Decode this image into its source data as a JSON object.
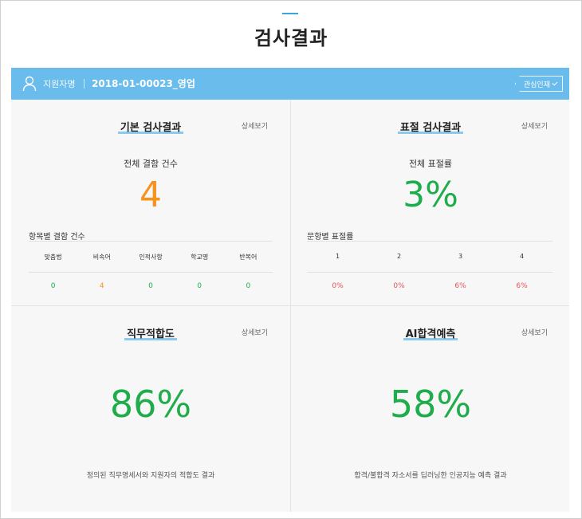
{
  "page_title": "검사결과",
  "applicant": {
    "label": "지원자명",
    "id": "2018-01-00023_영업",
    "interest_button": "관심인재"
  },
  "basic": {
    "title": "기본 검사결과",
    "detail": "상세보기",
    "total_label": "전체 결함 건수",
    "total_value": "4",
    "table_label": "항목별 결함 건수",
    "columns": [
      "맞춤법",
      "비속어",
      "인적사항",
      "학교명",
      "반복어"
    ],
    "values": [
      "0",
      "4",
      "0",
      "0",
      "0"
    ]
  },
  "plagiarism": {
    "title": "표절 검사결과",
    "detail": "상세보기",
    "total_label": "전체 표절률",
    "total_value": "3%",
    "table_label": "문항별 표절률",
    "columns": [
      "1",
      "2",
      "3",
      "4"
    ],
    "values": [
      "0%",
      "0%",
      "6%",
      "6%"
    ]
  },
  "fit": {
    "title": "직무적합도",
    "detail": "상세보기",
    "value": "86%",
    "caption": "정의된 직무명세서와 지원자의 적합도 결과"
  },
  "ai": {
    "title": "AI합격예측",
    "detail": "상세보기",
    "value": "58%",
    "caption": "합격/불합격 자소서를 딥러닝한 인공지능 예측 결과"
  },
  "colors": {
    "header_bar": "#6abcec",
    "orange": "#f5931e",
    "green": "#1fad4c",
    "red": "#e8505b"
  }
}
